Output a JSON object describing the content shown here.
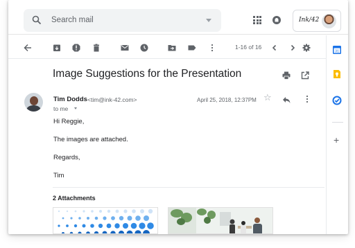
{
  "header": {
    "search_placeholder": "Search mail",
    "account_brand": "Ink/42"
  },
  "toolbar": {
    "pager": "1-16 of 16"
  },
  "message": {
    "subject": "Image Suggestions for the Presentation",
    "sender_name": "Tim Dodds",
    "sender_email": "<tim@ink-42.com>",
    "to_line": "to me",
    "date": "April 25, 2018, 12:37PM",
    "body_lines": [
      "Hi Reggie,",
      "The images are attached.",
      "Regards,",
      "Tim"
    ]
  },
  "attachments": {
    "title": "2 Attachments"
  },
  "icons": {
    "toolbar": [
      "back-arrow-icon",
      "archive-icon",
      "report-spam-icon",
      "delete-icon",
      "mark-unread-icon",
      "snooze-icon",
      "move-to-icon",
      "labels-icon",
      "more-vert-icon",
      "older-chevron-icon",
      "newer-chevron-icon",
      "settings-icon"
    ],
    "side": [
      "calendar-icon",
      "keep-icon",
      "tasks-icon",
      "add-icon"
    ]
  },
  "colors": {
    "calendar": "#1a73e8",
    "keep": "#fbbc04",
    "tasks": "#1a73e8",
    "icon_gray": "#5f6368"
  }
}
